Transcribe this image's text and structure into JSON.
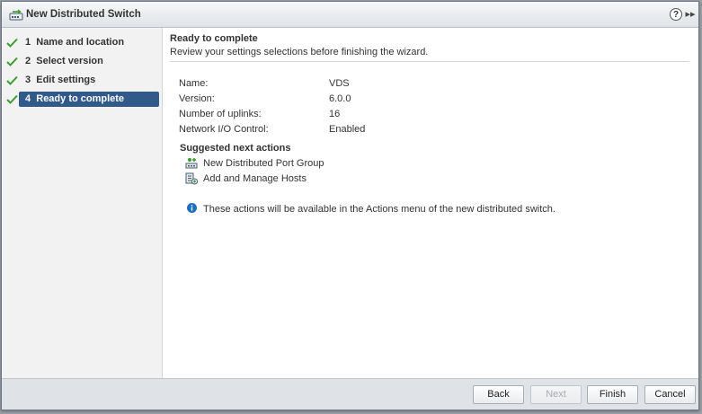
{
  "window": {
    "title": "New Distributed Switch",
    "help_label": "?",
    "expand_label": "▸▸"
  },
  "steps": [
    {
      "number": "1",
      "label": "Name and location",
      "completed": true,
      "active": false
    },
    {
      "number": "2",
      "label": "Select version",
      "completed": true,
      "active": false
    },
    {
      "number": "3",
      "label": "Edit settings",
      "completed": true,
      "active": false
    },
    {
      "number": "4",
      "label": "Ready to complete",
      "completed": true,
      "active": true
    }
  ],
  "main": {
    "title": "Ready to complete",
    "subtitle": "Review your settings selections before finishing the wizard.",
    "summary": [
      {
        "label": "Name:",
        "value": "VDS"
      },
      {
        "label": "Version:",
        "value": "6.0.0"
      },
      {
        "label": "Number of uplinks:",
        "value": "16"
      },
      {
        "label": "Network I/O Control:",
        "value": "Enabled"
      }
    ],
    "next_actions_title": "Suggested next actions",
    "next_actions": [
      {
        "label": "New Distributed Port Group",
        "icon": "port-group-icon"
      },
      {
        "label": "Add and Manage Hosts",
        "icon": "manage-hosts-icon"
      }
    ],
    "info_text": "These actions will be available in the Actions menu of the new distributed switch."
  },
  "footer": {
    "back_label": "Back",
    "next_label": "Next",
    "finish_label": "Finish",
    "cancel_label": "Cancel"
  },
  "colors": {
    "active_step": "#315a8a",
    "check": "#3a9b2e",
    "info": "#1f6fbf"
  }
}
